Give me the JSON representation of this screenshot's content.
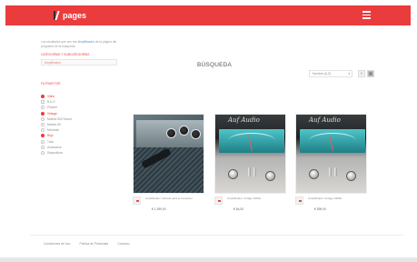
{
  "header": {
    "logo_text": "pages",
    "menu_icon": "hamburger-menu-icon",
    "accent_color": "#ea3c3d"
  },
  "sidebar": {
    "note_prefix": "Los resultados que ves son",
    "note_link": "Amplificador",
    "note_suffix": "de la página del programa de la búsqueda",
    "category_label": "CATEGORÍAS Y SUBCATEGORÍAS",
    "search_value": "Amplificador",
    "filter_label": "FILTRAR POR",
    "filters": [
      {
        "label": "Vidrio",
        "state": "red"
      },
      {
        "label": "B & O",
        "state": "square"
      },
      {
        "label": "Pioneer",
        "state": "empty"
      },
      {
        "label": "Vintage",
        "state": "red"
      },
      {
        "label": "Modelo 500 Sound",
        "state": "empty"
      },
      {
        "label": "Modelo 90",
        "state": "empty"
      },
      {
        "label": "McIntosh",
        "state": "empty"
      },
      {
        "label": "Rojo",
        "state": "red"
      },
      {
        "label": "Tubo",
        "state": "empty"
      },
      {
        "label": "Accesorios",
        "state": "empty"
      },
      {
        "label": "Dispositivos",
        "state": "empty"
      }
    ]
  },
  "main": {
    "title": "BÚSQUEDA",
    "sort_value": "Nombre (A-Z)",
    "products": [
      {
        "name": "Amplificador Vertical para el transistor",
        "price": "€ 1.399,00"
      },
      {
        "name": "Amplificador vintage 1980s",
        "price": "€ 84,00"
      },
      {
        "name": "Amplificador vintage 1980s",
        "price": "€ 899,00"
      }
    ]
  },
  "footer": {
    "links": [
      "Condiciones de Uso",
      "Política de Privacidad",
      "Contacto"
    ]
  },
  "photo_text": "Auf Audio"
}
